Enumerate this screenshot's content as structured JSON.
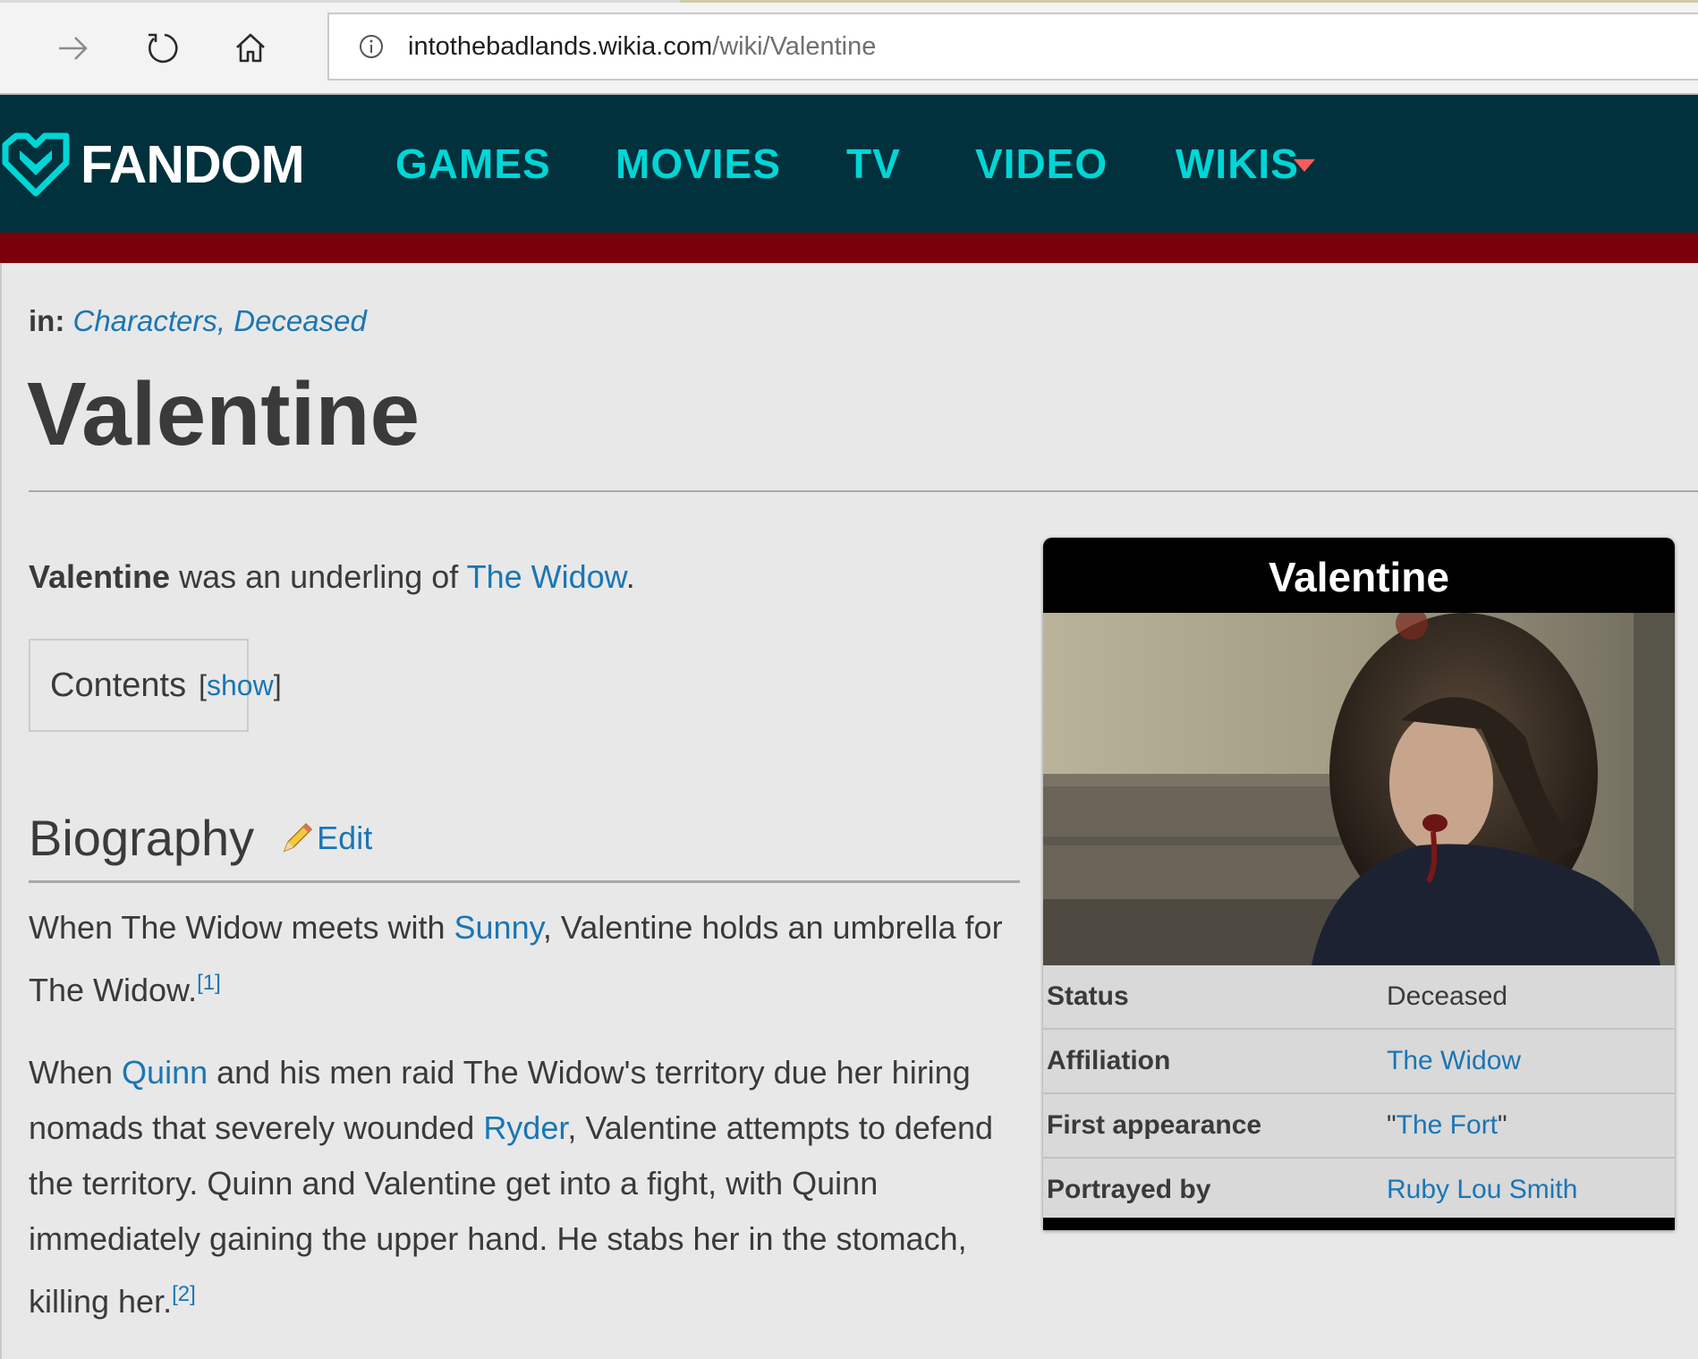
{
  "browser": {
    "url_host": "intothebadlands.wikia.com",
    "url_path": "/wiki/Valentine"
  },
  "header": {
    "logo_text": "FANDOM",
    "nav": [
      "GAMES",
      "MOVIES",
      "TV",
      "VIDEO",
      "WIKIS"
    ],
    "colors": {
      "bg": "#00313c",
      "nav": "#00d6d6",
      "accent": "#7a000c"
    }
  },
  "page": {
    "categories_label": "in:",
    "categories": [
      "Characters",
      "Deceased"
    ],
    "title": "Valentine",
    "intro": {
      "name": "Valentine",
      "text": " was an underling of ",
      "link": "The Widow",
      "end": "."
    },
    "toc": {
      "label": "Contents",
      "toggle": "show"
    },
    "section": {
      "heading": "Biography",
      "edit": "Edit"
    },
    "para1": {
      "t1": "When The Widow meets with ",
      "link1": "Sunny",
      "t2": ", Valentine holds an umbrella for The Widow.",
      "ref": "[1]"
    },
    "para2": {
      "t1": "When ",
      "link1": "Quinn",
      "t2": " and his men raid The Widow's territory due her hiring nomads that severely wounded ",
      "link2": "Ryder",
      "t3": ", Valentine attempts to defend the territory. Quinn and Valentine get into a fight, with Quinn immediately gaining the upper hand. He stabs her in the stomach, killing her.",
      "ref": "[2]"
    }
  },
  "infobox": {
    "title": "Valentine",
    "rows": [
      {
        "key": "Status",
        "value": "Deceased"
      },
      {
        "key": "Affiliation",
        "value": "The Widow"
      },
      {
        "key": "First appearance",
        "value": "The Fort"
      },
      {
        "key": "Portrayed by",
        "value": "Ruby Lou Smith"
      }
    ]
  },
  "icons": [
    "forward-icon",
    "refresh-icon",
    "home-icon",
    "info-icon",
    "fandom-heart-icon",
    "pencil-icon",
    "dropdown-caret-icon"
  ]
}
